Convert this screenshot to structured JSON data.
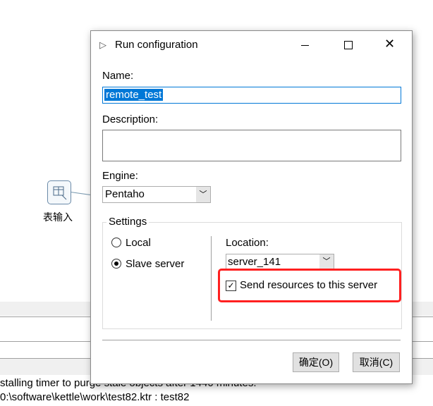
{
  "canvas": {
    "step_label": "表输入",
    "step_icon": "table-input-icon"
  },
  "log": {
    "lines": [
      "stalling timer to purge stale objects after 1440 minutes.",
      "0:\\software\\kettle\\work\\test82.ktr : test82"
    ]
  },
  "dialog": {
    "title": "Run configuration",
    "name_label": "Name:",
    "name_value": "remote_test",
    "description_label": "Description:",
    "description_value": "",
    "engine_label": "Engine:",
    "engine_value": "Pentaho",
    "settings_label": "Settings",
    "local_label": "Local",
    "slave_label": "Slave server",
    "selected": "Slave server",
    "location_label": "Location:",
    "location_value": "server_141",
    "send_resources_label": "Send resources to this server",
    "send_resources_checked": true,
    "ok_label": "确定(O)",
    "cancel_label": "取消(C)",
    "highlight_color": "#ff2020"
  }
}
